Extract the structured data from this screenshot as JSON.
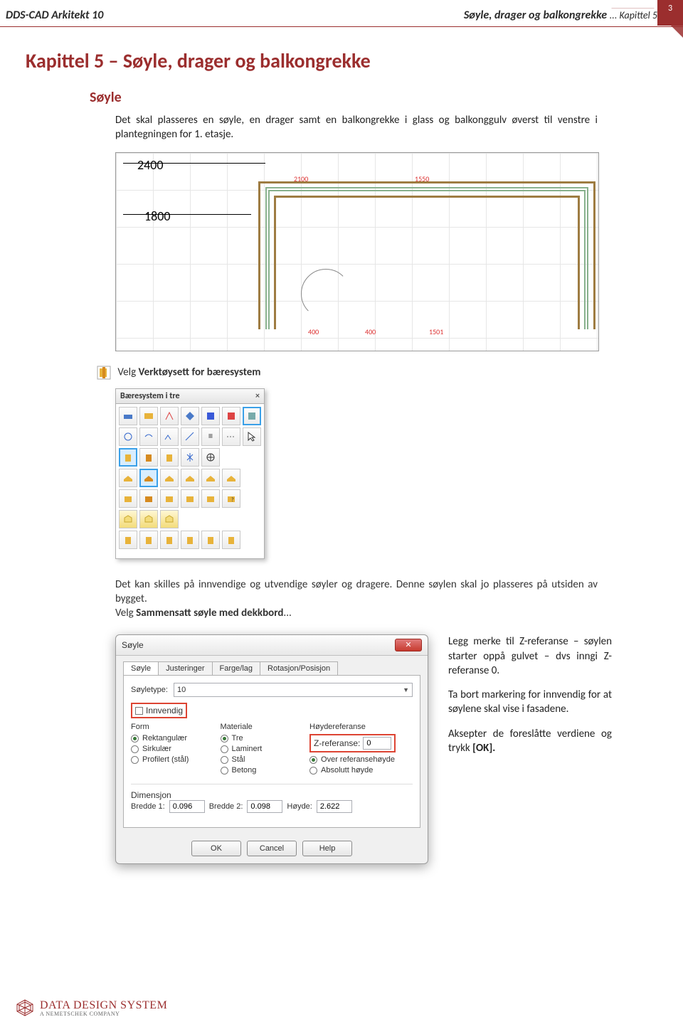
{
  "page_number": "3",
  "header": {
    "left": "DDS-CAD Arkitekt 10",
    "right_title": "Søyle, drager og balkongrekke",
    "right_sub": "... Kapittel 5"
  },
  "chapter_title": "Kapittel 5 – Søyle, drager og balkongrekke",
  "section_title": "Søyle",
  "intro_text": "Det skal plasseres en søyle, en drager samt en balkongrekke i glass og balkonggulv øverst til venstre i plantegningen for 1. etasje.",
  "cad": {
    "dim_top": "2400",
    "dim_mid": "1800",
    "red": {
      "d1": "2100",
      "d2": "1550",
      "d3": "400",
      "d4": "400",
      "d5": "1501"
    }
  },
  "verktoy_label_prefix": "Velg ",
  "verktoy_label_bold": "Verktøysett for bæresystem",
  "palette": {
    "title": "Bæresystem i tre",
    "close": "×"
  },
  "para2_1": "Det kan skilles på innvendige og utvendige søyler og dragere. Denne søylen skal jo plasseres på utsiden av bygget.",
  "para2_2_prefix": "Velg ",
  "para2_2_bold": "Sammensatt søyle med dekkbord",
  "para2_2_suffix": "...",
  "dialog": {
    "title": "Søyle",
    "tabs": [
      "Søyle",
      "Justeringer",
      "Farge/lag",
      "Rotasjon/Posisjon"
    ],
    "soyletype_label": "Søyletype:",
    "soyletype_value": "10",
    "innvendig_label": "Innvendig",
    "group_form": "Form",
    "form_options": [
      "Rektangulær",
      "Sirkulær",
      "Profilert (stål)"
    ],
    "group_mat": "Materiale",
    "mat_options": [
      "Tre",
      "Laminert",
      "Stål",
      "Betong"
    ],
    "group_hoy": "Høydereferanse",
    "zref_label": "Z-referanse:",
    "zref_value": "0",
    "hoy_options": [
      "Over referansehøyde",
      "Absolutt høyde"
    ],
    "dim_title": "Dimensjon",
    "bredde1_label": "Bredde 1:",
    "bredde1_value": "0.096",
    "bredde2_label": "Bredde 2:",
    "bredde2_value": "0.098",
    "hoyde_label": "Høyde:",
    "hoyde_value": "2.622",
    "buttons": {
      "ok": "OK",
      "cancel": "Cancel",
      "help": "Help"
    }
  },
  "side_note": {
    "p1": "Legg merke til Z-referanse – søylen starter oppå gulvet – dvs inngi Z-referanse 0.",
    "p2": "Ta bort markering for innvendig for at søylene skal vise i fasadene.",
    "p3_prefix": "Aksepter de foreslåtte verdiene og trykk ",
    "p3_bold": "[OK].",
    "p3_suffix": ""
  },
  "footer": {
    "name": "DATA DESIGN SYSTEM",
    "sub": "A NEMETSCHEK COMPANY"
  }
}
